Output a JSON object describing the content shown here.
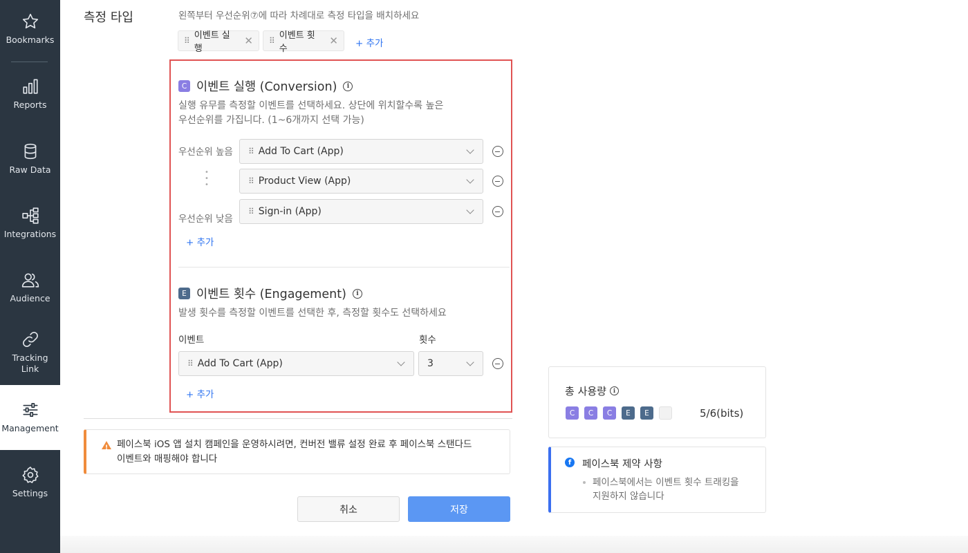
{
  "sidebar": {
    "items": [
      {
        "label": "Bookmarks",
        "icon": "star-icon"
      },
      {
        "label": "Reports",
        "icon": "bar-chart-icon"
      },
      {
        "label": "Raw Data",
        "icon": "database-icon"
      },
      {
        "label": "Integrations",
        "icon": "integrations-icon"
      },
      {
        "label": "Audience",
        "icon": "users-icon"
      },
      {
        "label": "Tracking\nLink",
        "icon": "link-icon"
      },
      {
        "label": "Management",
        "icon": "sliders-icon",
        "active": true
      },
      {
        "label": "Settings",
        "icon": "gear-icon"
      }
    ]
  },
  "measure": {
    "title": "측정 타입",
    "hint": "왼쪽부터 우선순위⑦에 따라 차례대로 측정 타입을 배치하세요",
    "chips": [
      "이벤트 실행",
      "이벤트 횟수"
    ],
    "add_label": "+ 추가"
  },
  "conversion": {
    "badge": "C",
    "title": "이벤트 실행 (Conversion)",
    "desc_line1": "실행 유무를 측정할 이벤트를 선택하세요. 상단에 위치할수록 높은",
    "desc_line2": "우선순위를 가집니다. (1~6개까지 선택 가능)",
    "priority_high": "우선순위 높음",
    "priority_low": "우선순위 낮음",
    "events": [
      "Add To Cart (App)",
      "Product View (App)",
      "Sign-in (App)"
    ],
    "add_label": "+ 추가"
  },
  "engagement": {
    "badge": "E",
    "title": "이벤트 횟수 (Engagement)",
    "desc": "발생 횟수를 측정할 이벤트를 선택한 후, 측정할 횟수도 선택하세요",
    "event_col": "이벤트",
    "count_col": "횟수",
    "event_value": "Add To Cart (App)",
    "count_value": "3",
    "add_label": "+ 추가"
  },
  "warning": {
    "line1": "페이스북 iOS 앱 설치 캠페인을 운영하시려면, 컨버전 밸류 설정 완료 후 페이스북 스탠다드",
    "line2": "이벤트와 매핑해야 합니다"
  },
  "buttons": {
    "cancel": "취소",
    "save": "저장"
  },
  "usage": {
    "title": "총 사용량",
    "bits": [
      "C",
      "C",
      "C",
      "E",
      "E",
      ""
    ],
    "value": "5/6(bits)"
  },
  "facebook": {
    "title": "페이스북 제약 사항",
    "note_line1": "페이스북에서는 이벤트 횟수 트래킹을",
    "note_line2": "지원하지 않습니다"
  },
  "colors": {
    "conversion": "#8a7ee3",
    "engagement": "#4d6b8c",
    "primary": "#5b97f3",
    "accent_red": "#e05252",
    "warning": "#f08c3c"
  }
}
